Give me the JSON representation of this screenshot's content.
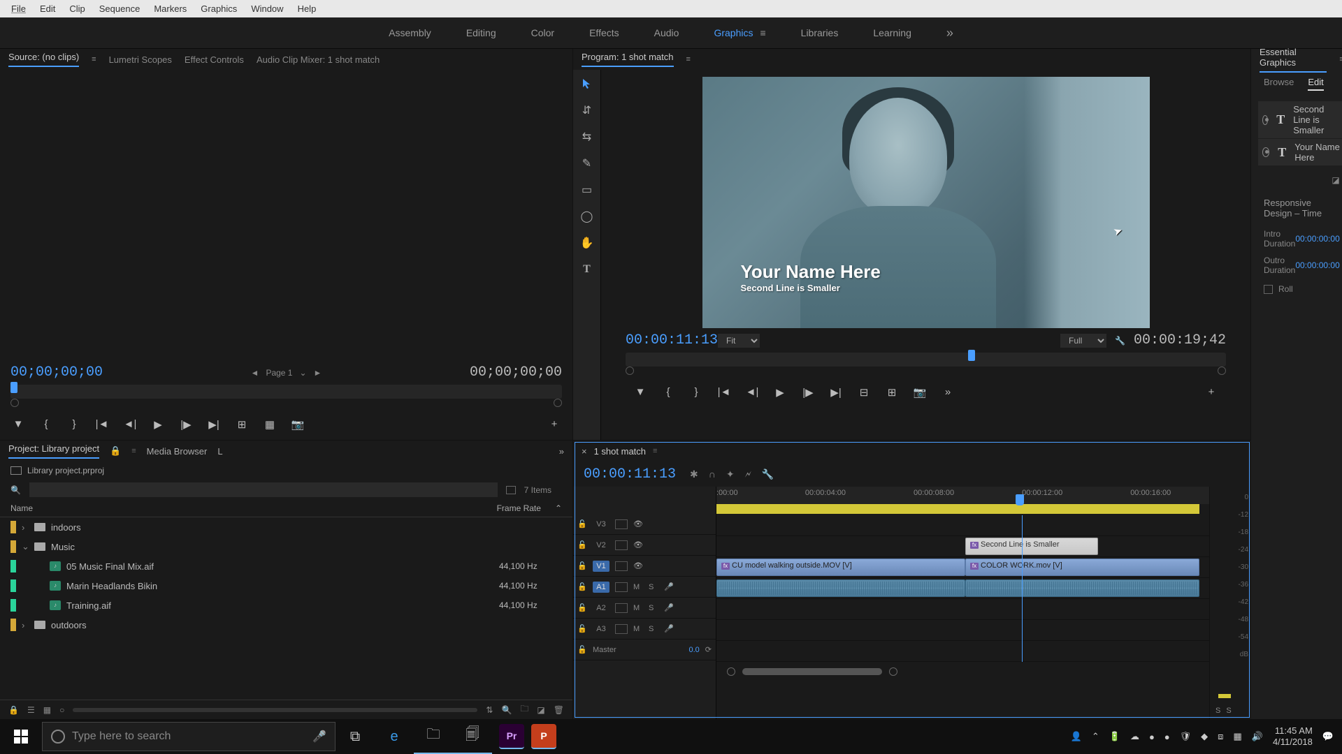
{
  "menu": [
    "File",
    "Edit",
    "Clip",
    "Sequence",
    "Markers",
    "Graphics",
    "Window",
    "Help"
  ],
  "workspaces": [
    "Assembly",
    "Editing",
    "Color",
    "Effects",
    "Audio",
    "Graphics",
    "Libraries",
    "Learning"
  ],
  "workspace_active": "Graphics",
  "source_panel": {
    "tabs": [
      "Source: (no clips)",
      "Lumetri Scopes",
      "Effect Controls",
      "Audio Clip Mixer: 1 shot match"
    ],
    "tc_left": "00;00;00;00",
    "page_label": "Page 1",
    "tc_right": "00;00;00;00"
  },
  "program_panel": {
    "tab": "Program: 1 shot match",
    "overlay_title": "Your Name Here",
    "overlay_subtitle": "Second Line is Smaller",
    "tc_left": "00:00:11:13",
    "fit_label": "Fit",
    "full_label": "Full",
    "tc_right": "00:00:19;42"
  },
  "essential": {
    "title": "Essential Graphics",
    "tabs": [
      "Browse",
      "Edit"
    ],
    "layers": [
      "Second Line is Smaller",
      "Your Name Here"
    ],
    "section_title": "Responsive Design – Time",
    "intro_label": "Intro Duration",
    "intro_val": "00:00:00:00",
    "outro_label": "Outro Duration",
    "outro_val": "00:00:00:00",
    "roll_label": "Roll"
  },
  "project": {
    "tabs": [
      "Project: Library project",
      "Media Browser",
      "L"
    ],
    "file": "Library project.prproj",
    "items_count": "7 Items",
    "columns": [
      "Name",
      "Frame Rate"
    ],
    "rows": [
      {
        "indent": 0,
        "chev": "›",
        "icon": "folder",
        "color": "#d4a838",
        "name": "indoors",
        "rate": ""
      },
      {
        "indent": 0,
        "chev": "⌄",
        "icon": "folder",
        "color": "#d4a838",
        "name": "Music",
        "rate": ""
      },
      {
        "indent": 1,
        "chev": "",
        "icon": "audio",
        "color": "#2ad49a",
        "name": "05 Music Final Mix.aif",
        "rate": "44,100 Hz"
      },
      {
        "indent": 1,
        "chev": "",
        "icon": "audio",
        "color": "#2ad49a",
        "name": "Marin Headlands Bikin",
        "rate": "44,100 Hz"
      },
      {
        "indent": 1,
        "chev": "",
        "icon": "audio",
        "color": "#2ad49a",
        "name": "Training.aif",
        "rate": "44,100 Hz"
      },
      {
        "indent": 0,
        "chev": "›",
        "icon": "folder",
        "color": "#d4a838",
        "name": "outdoors",
        "rate": ""
      }
    ]
  },
  "timeline": {
    "tab": "1 shot match",
    "tc": "00:00:11:13",
    "ruler": [
      ":00:00",
      "00:00:04:00",
      "00:00:08:00",
      "00:00:12:00",
      "00:00:16:00"
    ],
    "tracks_v": [
      "V3",
      "V2",
      "V1"
    ],
    "tracks_a": [
      "A1",
      "A2",
      "A3"
    ],
    "master_label": "Master",
    "master_val": "0.0",
    "clips": {
      "v2_graphic": "Second Line is Smaller",
      "v1_clip1": "CU model walking outside.MOV [V]",
      "v1_clip2": "COLOR WORK.mov [V]"
    },
    "meter_labels": [
      "0",
      "-12",
      "-18",
      "-24",
      "-30",
      "-36",
      "-42",
      "-48",
      "-54",
      "dB"
    ],
    "meter_footer": [
      "S",
      "S"
    ]
  },
  "taskbar": {
    "search_placeholder": "Type here to search",
    "time": "11:45 AM",
    "date": "4/11/2018"
  }
}
